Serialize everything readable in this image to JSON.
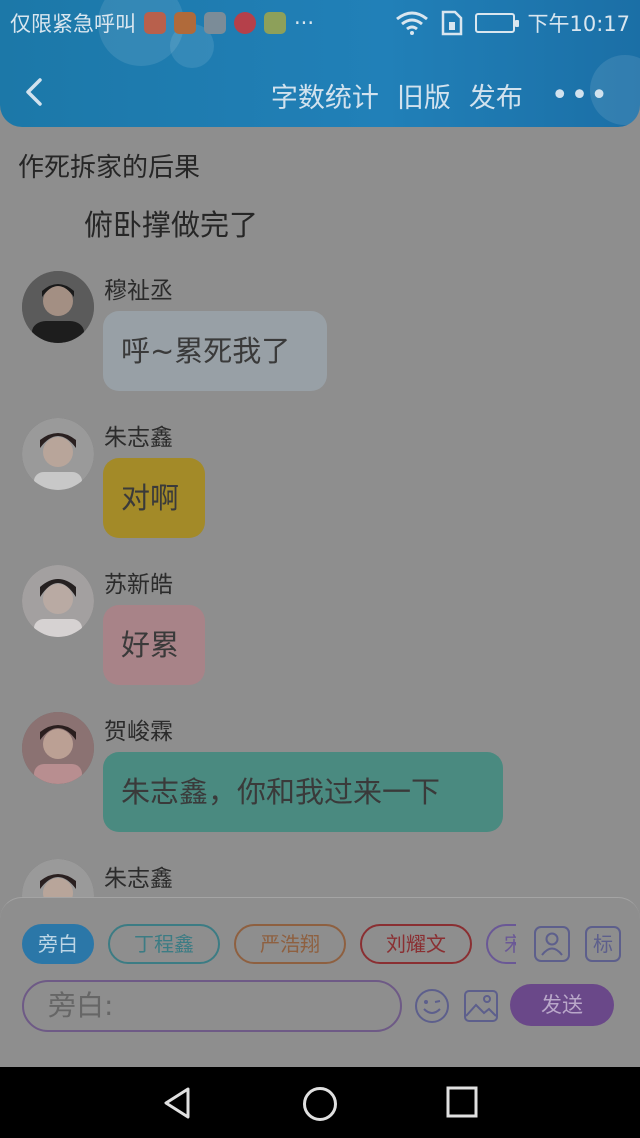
{
  "status_bar": {
    "carrier": "仅限紧急呼叫",
    "time": "下午10:17"
  },
  "header": {
    "actions": [
      "字数统计",
      "旧版",
      "发布"
    ],
    "more": "•••"
  },
  "story": {
    "title": "作死拆家的后果",
    "narration": "俯卧撑做完了"
  },
  "messages": [
    {
      "name": "穆祉丞",
      "text": "呼~累死我了",
      "color": "#98a0a6"
    },
    {
      "name": "朱志鑫",
      "text": "对啊",
      "color": "#a38a28"
    },
    {
      "name": "苏新皓",
      "text": "好累",
      "color": "#a88388"
    },
    {
      "name": "贺峻霖",
      "text": "朱志鑫，你和我过来一下",
      "color": "#4a8a80"
    },
    {
      "name": "朱志鑫",
      "text": "",
      "color": ""
    }
  ],
  "input_panel": {
    "roles": [
      {
        "label": "旁白",
        "color": "#2b77a8",
        "active": true
      },
      {
        "label": "丁程鑫",
        "color": "#3c7c84",
        "active": false
      },
      {
        "label": "严浩翔",
        "color": "#8e6040",
        "active": false
      },
      {
        "label": "刘耀文",
        "color": "#8a2f32",
        "active": false
      },
      {
        "label": "宋亚轩",
        "color": "#6a5896",
        "active": false
      }
    ],
    "tag_button": "标",
    "input_value": "旁白:",
    "send_label": "发送"
  }
}
